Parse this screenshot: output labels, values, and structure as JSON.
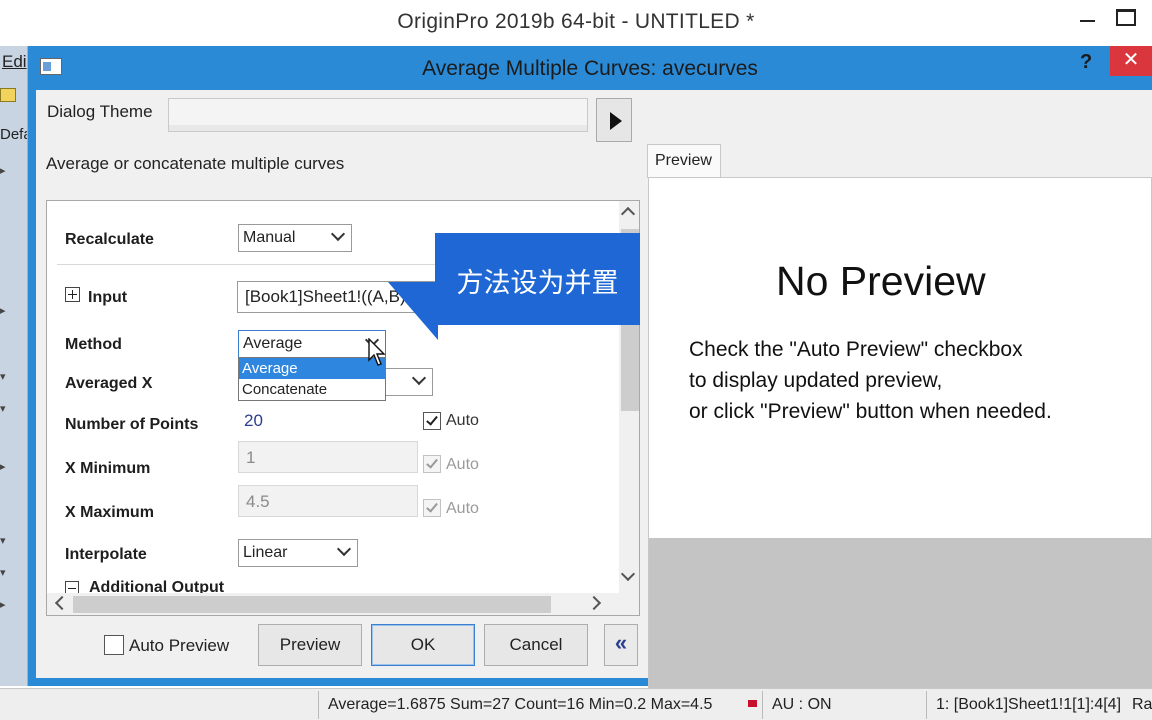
{
  "app": {
    "title": "OriginPro 2019b 64-bit - UNTITLED *",
    "menu_edit": "Edi",
    "left_default": "Defa"
  },
  "dialog": {
    "title": "Average Multiple Curves: avecurves",
    "help": "?",
    "close": "✕",
    "theme_label": "Dialog Theme",
    "theme_value": "",
    "description": "Average or concatenate multiple curves"
  },
  "settings": {
    "recalculate": {
      "label": "Recalculate",
      "value": "Manual"
    },
    "input": {
      "label": "Input",
      "value": "[Book1]Sheet1!((A,B),("
    },
    "method": {
      "label": "Method",
      "value": "Average",
      "options": [
        "Average",
        "Concatenate"
      ],
      "highlighted": "Average"
    },
    "averaged_x": {
      "label": "Averaged X"
    },
    "number_of_points": {
      "label": "Number of Points",
      "value": "20",
      "auto_label": "Auto",
      "auto_checked": true
    },
    "x_minimum": {
      "label": "X Minimum",
      "value": "1",
      "auto_label": "Auto",
      "auto_checked": true
    },
    "x_maximum": {
      "label": "X Maximum",
      "value": "4.5",
      "auto_label": "Auto",
      "auto_checked": true
    },
    "interpolate": {
      "label": "Interpolate",
      "value": "Linear"
    },
    "additional_output": {
      "label": "Additional Output"
    }
  },
  "buttons": {
    "auto_preview": "Auto Preview",
    "preview": "Preview",
    "ok": "OK",
    "cancel": "Cancel",
    "collapse": "«"
  },
  "preview": {
    "tab": "Preview",
    "heading": "No Preview",
    "lines": [
      "Check the \"Auto Preview\" checkbox",
      "to display updated preview,",
      "or click \"Preview\" button when needed."
    ]
  },
  "callout": {
    "text": "方法设为并置"
  },
  "statusbar": {
    "stats": "Average=1.6875 Sum=27 Count=16 Min=0.2 Max=4.5",
    "au": "AU : ON",
    "range": "1: [Book1]Sheet1!1[1]:4[4]",
    "tail": "Ra"
  },
  "colors": {
    "dialog_border": "#2a8ad6",
    "close_button": "#d9363e",
    "callout": "#1e67d4",
    "selection": "#2e86de"
  }
}
